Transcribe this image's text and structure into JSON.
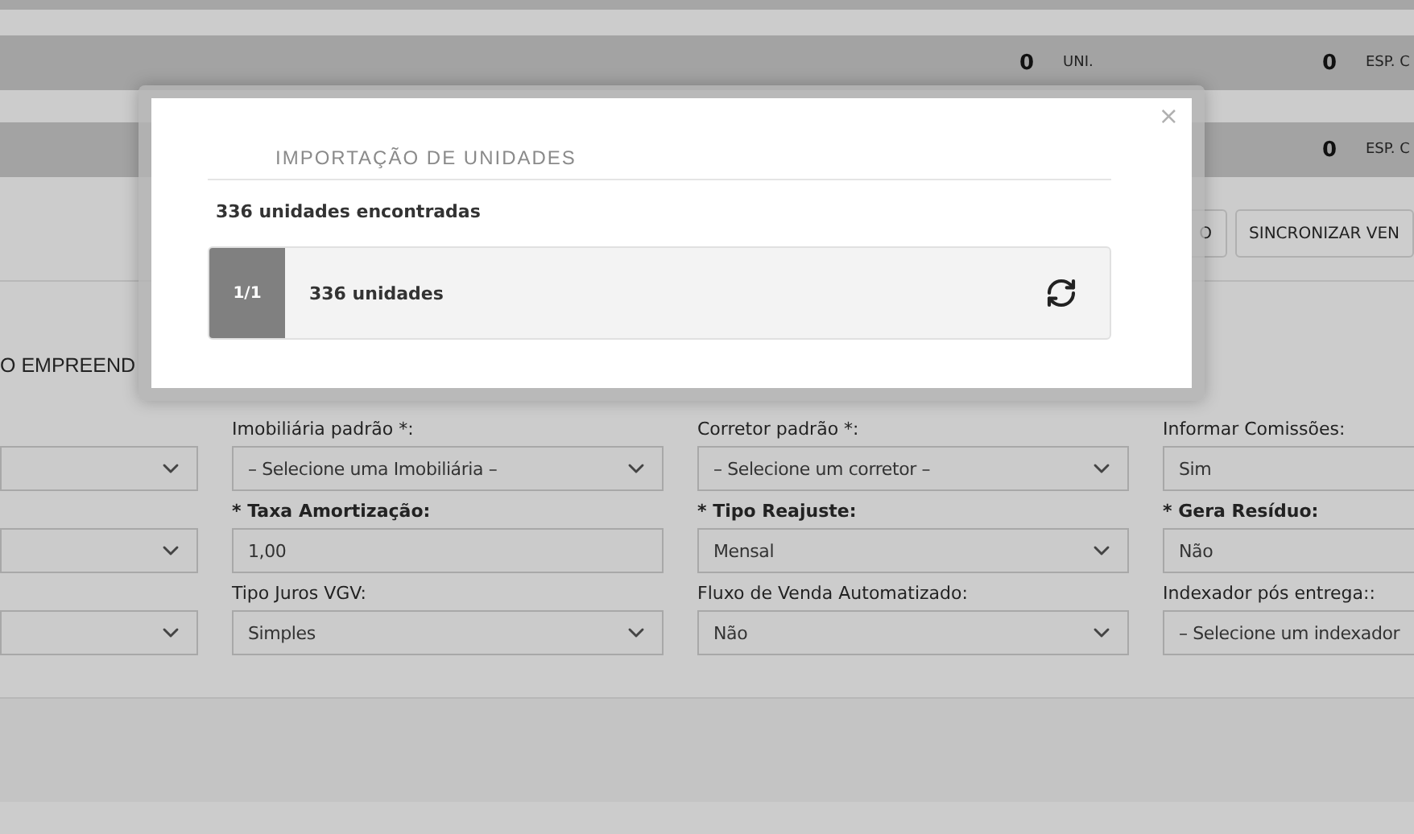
{
  "summary_rows": [
    {
      "cells": [
        {
          "value": "0",
          "unit": "UNI."
        },
        {
          "value": "0",
          "unit": "ESP. C"
        }
      ]
    },
    {
      "cells": [
        {
          "value": "0",
          "unit": "ESP. C"
        }
      ]
    }
  ],
  "toolbar": {
    "buttons": [
      "O",
      "SINCRONIZAR VEN"
    ]
  },
  "section_title": "O EMPREEND",
  "form": {
    "rows": [
      {
        "fields": [
          {
            "kind": "select"
          },
          {
            "kind": "select",
            "label": "Imobiliária padrão *:",
            "required": false,
            "value": "– Selecione uma Imobiliária –"
          },
          {
            "kind": "select",
            "label": "Corretor padrão *:",
            "required": false,
            "value": "– Selecione um corretor –"
          },
          {
            "kind": "select",
            "label": "Informar Comissões:",
            "required": false,
            "value": "Sim"
          }
        ]
      },
      {
        "fields": [
          {
            "kind": "select"
          },
          {
            "kind": "input",
            "label": "* Taxa Amortização:",
            "required": true,
            "value": "1,00"
          },
          {
            "kind": "select",
            "label": "* Tipo Reajuste:",
            "required": true,
            "value": "Mensal"
          },
          {
            "kind": "select",
            "label": "* Gera Resíduo:",
            "required": true,
            "value": "Não"
          }
        ]
      },
      {
        "fields": [
          {
            "kind": "select"
          },
          {
            "kind": "select",
            "label": "Tipo Juros VGV:",
            "required": false,
            "value": "Simples"
          },
          {
            "kind": "select",
            "label": "Fluxo de Venda Automatizado:",
            "required": false,
            "value": "Não"
          },
          {
            "kind": "select",
            "label": "Indexador pós entrega::",
            "required": false,
            "value": "– Selecione um indexador"
          }
        ]
      }
    ]
  },
  "modal": {
    "close": "×",
    "title": "IMPORTAÇÃO DE UNIDADES",
    "found": "336 unidades encontradas",
    "batches": [
      {
        "index": "1/1",
        "label": "336 unidades"
      }
    ]
  }
}
